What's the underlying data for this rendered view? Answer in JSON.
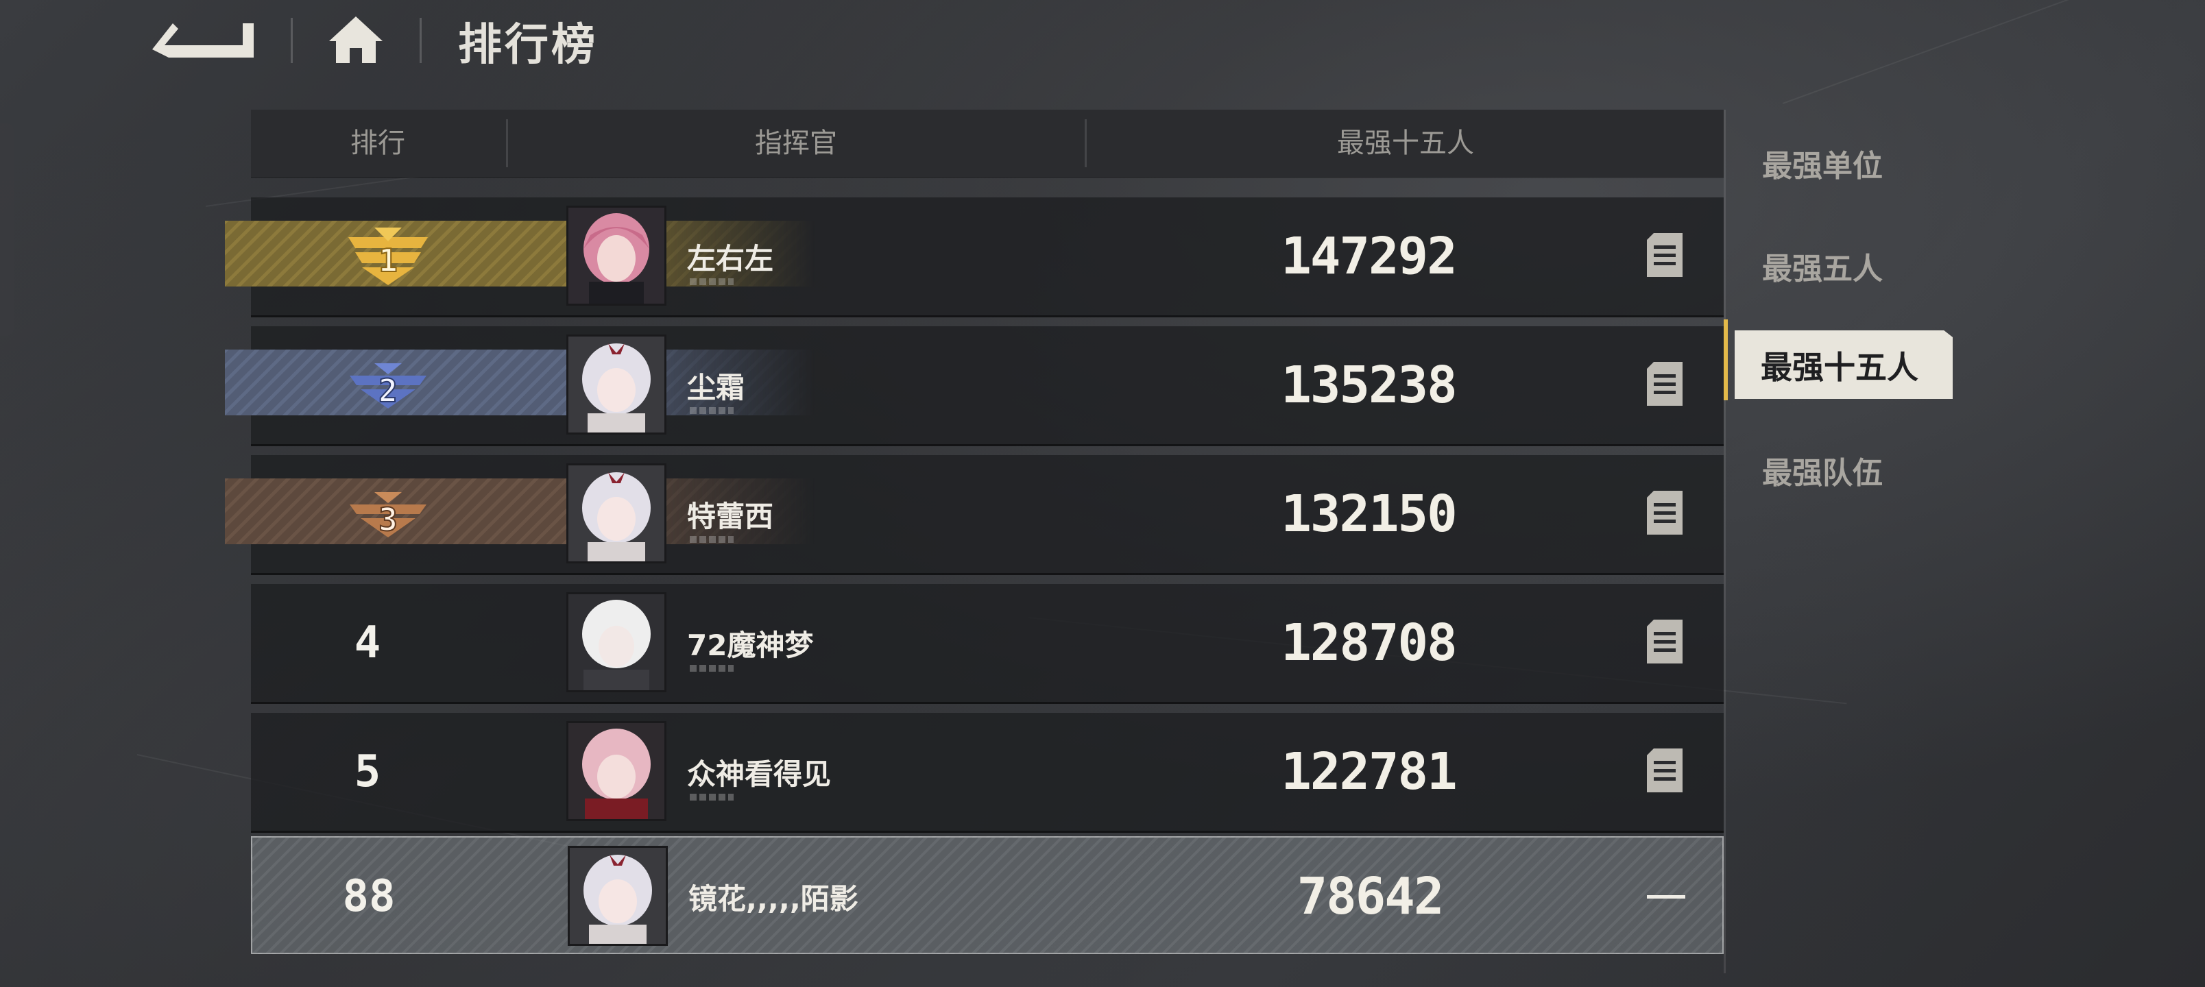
{
  "header": {
    "title": "排行榜",
    "back_icon": "back-arrow-icon",
    "home_icon": "home-icon"
  },
  "table": {
    "columns": [
      "排行",
      "指挥官",
      "最强十五人"
    ],
    "rows": [
      {
        "rank": "1",
        "badge": "gold",
        "name": "左右左",
        "score": "147292",
        "action": "detail-icon"
      },
      {
        "rank": "2",
        "badge": "silver",
        "name": "尘霜",
        "score": "135238",
        "action": "detail-icon"
      },
      {
        "rank": "3",
        "badge": "bronze",
        "name": "特蕾西",
        "score": "132150",
        "action": "detail-icon"
      },
      {
        "rank": "4",
        "badge": "",
        "name": "72魔神梦",
        "score": "128708",
        "action": "detail-icon"
      },
      {
        "rank": "5",
        "badge": "",
        "name": "众神看得见",
        "score": "122781",
        "action": "detail-icon"
      }
    ],
    "self_row": {
      "rank": "88",
      "name": "镜花,,,,,陌影",
      "score": "78642",
      "action": "dash-icon"
    }
  },
  "menu": {
    "items": [
      "最强单位",
      "最强五人",
      "最强十五人",
      "最强队伍"
    ],
    "active": "最强十五人"
  },
  "colors": {
    "gold": "#c9a23a",
    "silver": "#5b6fa8",
    "bronze": "#b0774c",
    "active_accent": "#e3b94a"
  }
}
